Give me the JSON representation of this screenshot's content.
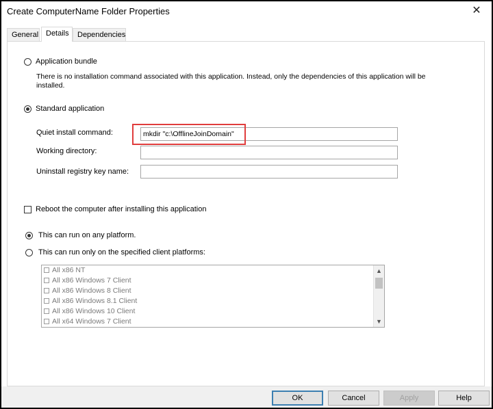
{
  "window": {
    "title": "Create ComputerName Folder Properties",
    "close_glyph": "✕"
  },
  "tabs": [
    {
      "label": "General"
    },
    {
      "label": "Details"
    },
    {
      "label": "Dependencies"
    }
  ],
  "details": {
    "app_bundle_label": "Application bundle",
    "app_bundle_desc": "There is no installation command associated with this application.  Instead, only the dependencies of this application will be installed.",
    "standard_app_label": "Standard application",
    "quiet_install_label": "Quiet install command:",
    "quiet_install_value": "mkdir \"c:\\OfflineJoinDomain\"",
    "working_dir_label": "Working directory:",
    "working_dir_value": "",
    "uninstall_key_label": "Uninstall registry key name:",
    "uninstall_key_value": "",
    "reboot_label": "Reboot the computer after installing this application",
    "any_platform_label": "This can run on any platform.",
    "specified_platforms_label": "This can run only on the specified client platforms:",
    "platforms": [
      "All x86 NT",
      "All x86 Windows 7 Client",
      "All x86 Windows 8 Client",
      "All x86 Windows 8.1 Client",
      "All x86 Windows 10 Client",
      "All x64 Windows 7 Client"
    ],
    "highlight_color": "#e03c3c"
  },
  "buttons": {
    "ok": "OK",
    "cancel": "Cancel",
    "apply": "Apply",
    "help": "Help"
  }
}
